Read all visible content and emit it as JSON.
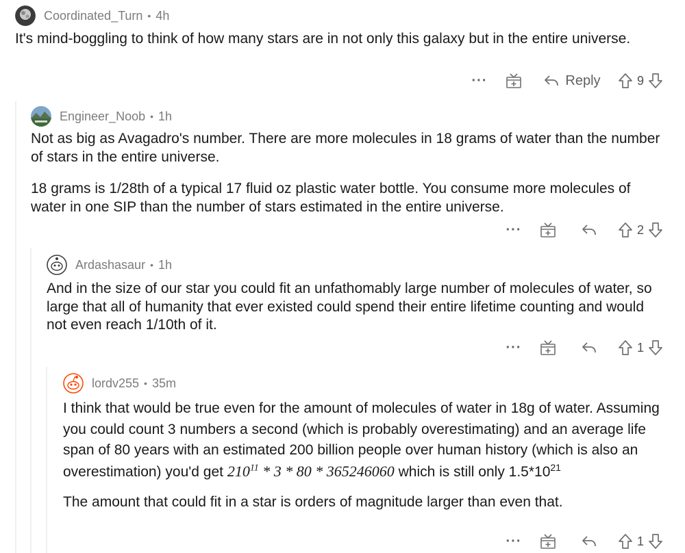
{
  "comments": [
    {
      "username": "Coordinated_Turn",
      "time": "4h",
      "text": "It's mind-boggling to think of how many stars are in not only this galaxy but in the entire universe.",
      "more": "···",
      "reply_label": "Reply",
      "score": "9"
    },
    {
      "username": "Engineer_Noob",
      "time": "1h",
      "paragraphs": [
        "Not as big as Avagadro's number. There are more molecules in 18 grams of water than the number of stars in the entire universe.",
        "18 grams is 1/28th of a typical 17 fluid oz plastic water bottle. You consume more molecules of water in one SIP than the number of stars estimated in the entire universe."
      ],
      "more": "···",
      "score": "2"
    },
    {
      "username": "Ardashasaur",
      "time": "1h",
      "text": "And in the size of our star you could fit an unfathomably large number of molecules of water, so large that all of humanity that ever existed could spend their entire lifetime counting and would not even reach 1/10th of it.",
      "more": "···",
      "score": "1"
    },
    {
      "username": "lordv255",
      "time": "35m",
      "text_intro": "I think that would be true even for the amount of molecules of water in 18g of water. Assuming you could count 3 numbers a second (which is probably overestimating) and an average life span of 80 years with an estimated 200 billion people over human history (which is also an overestimation) you'd get ",
      "formula_base": "210",
      "formula_exp": "11",
      "formula_rest": " * 3 * 80 * 365246060",
      "text_after_formula": " which is still only 1.5*10",
      "final_exp": "21",
      "paragraph2": "The amount that could fit in a star is orders of magnitude larger than even that.",
      "more": "···",
      "score": "1"
    }
  ]
}
